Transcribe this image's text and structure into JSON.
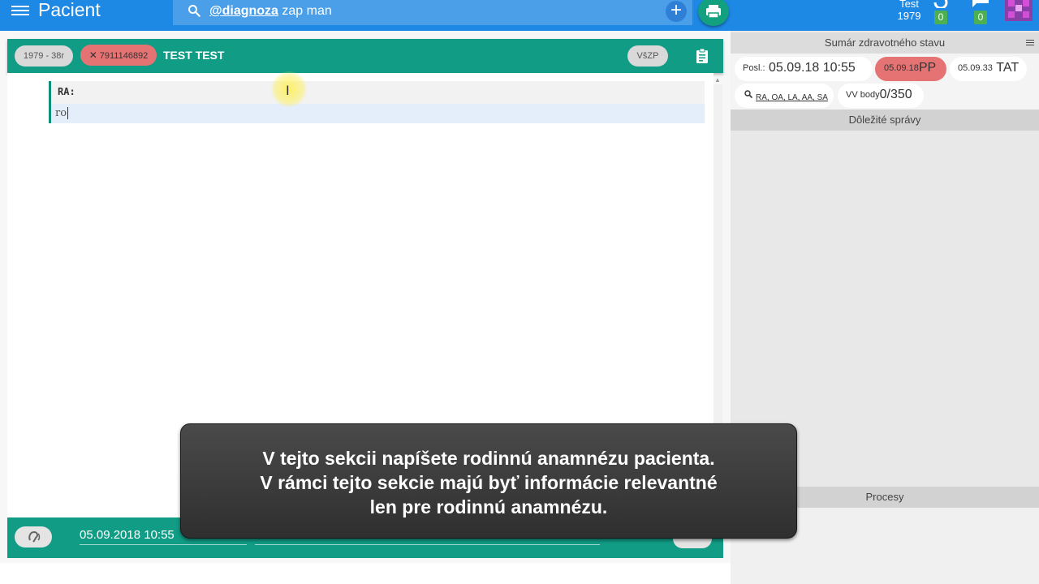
{
  "header": {
    "title": "Pacient",
    "search": {
      "keyword": "@diagnoza",
      "rest": " zap man"
    },
    "plus": "+",
    "user": {
      "name": "Test",
      "year": "1979"
    },
    "sync_count": "0",
    "messages_count": "0"
  },
  "patient": {
    "age_chip": "1979 - 38r",
    "id_chip": "7911146892",
    "name": "TEST TEST",
    "insurance": "VšZP"
  },
  "editor": {
    "section_label": "RA:",
    "input_value": "ro"
  },
  "footer": {
    "datetime": "05.09.2018 10:55"
  },
  "summary": {
    "title": "Sumár zdravotného stavu",
    "last_prefix": "Posl.:",
    "last_value": "05.09.18 10:55",
    "pp_date": "05.09.18",
    "pp_label": "PP",
    "tat_date": "05.09.33",
    "tat_label": "TAT",
    "ra_links": "RA, OA, LA, AA, SA",
    "vv_prefix": "VV body",
    "vv_value": "0/350"
  },
  "messages": {
    "title": "Dôležité správy"
  },
  "processes": {
    "title": "Procesy"
  },
  "caption": {
    "line1": "V tejto sekcii napíšete rodinnú anamnézu pacienta.",
    "line2": "V rámci tejto sekcie majú byť informácie relevantné",
    "line3": "len pre rodinnú anamnézu."
  },
  "colors": {
    "header_blue": "#1e88e5",
    "teal": "#119c86",
    "alert_red": "#e57373",
    "badge_green": "#4caf50"
  },
  "icons": [
    "menu-icon",
    "search-icon",
    "plus-icon",
    "print-icon",
    "sync-icon",
    "chat-icon",
    "clipboard-icon",
    "ear-icon",
    "search-small-icon",
    "hamburger-icon"
  ]
}
